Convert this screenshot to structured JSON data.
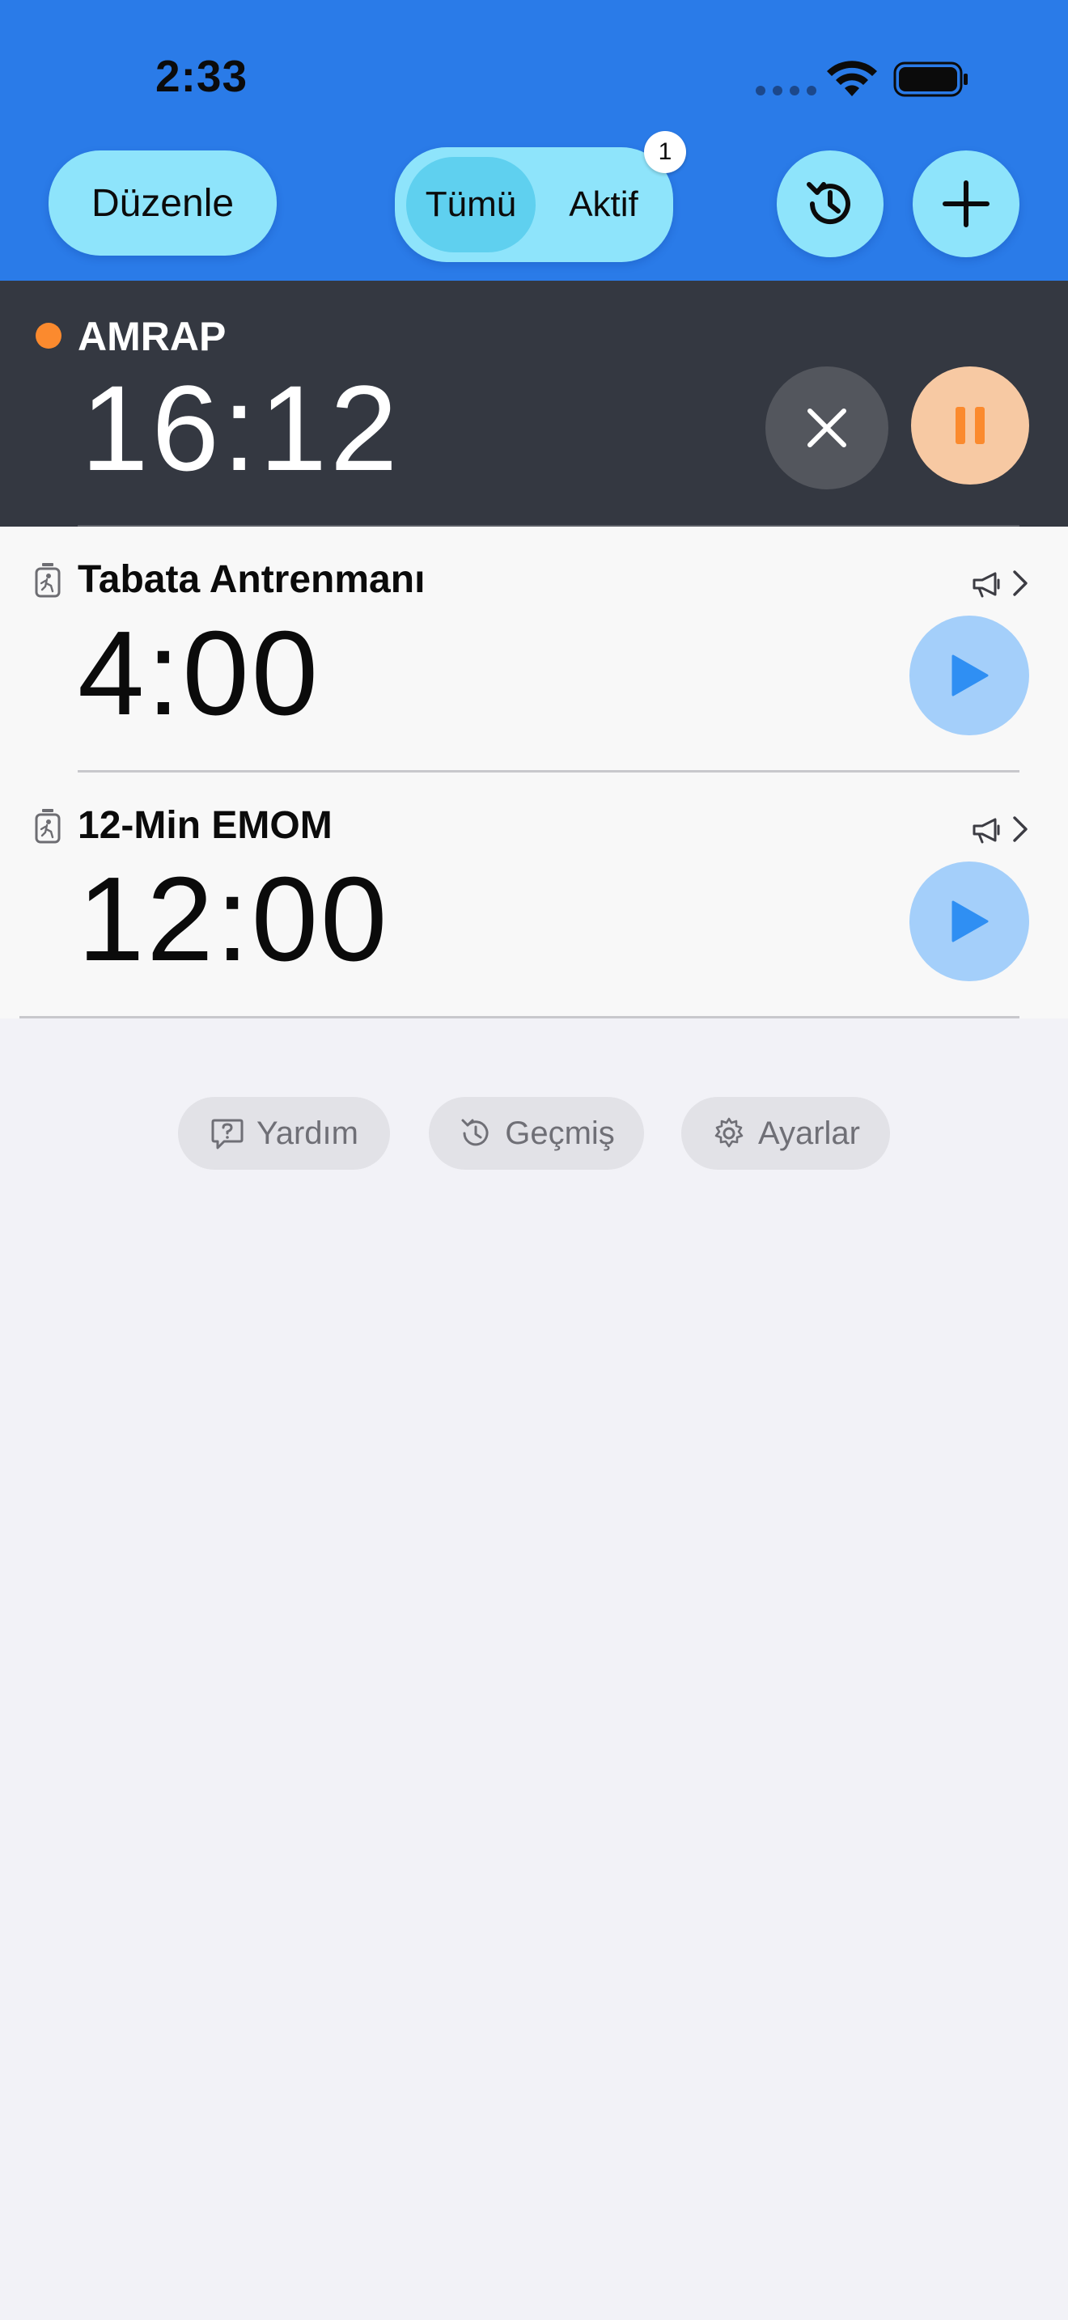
{
  "status_bar": {
    "time": "2:33",
    "icons": [
      "signal-dots-icon",
      "wifi-icon",
      "battery-icon"
    ]
  },
  "header": {
    "edit_label": "Düzenle",
    "segments": [
      {
        "label": "Tümü",
        "selected": true
      },
      {
        "label": "Aktif",
        "selected": false
      }
    ],
    "active_badge": "1",
    "buttons": [
      "history-icon",
      "plus-icon"
    ]
  },
  "active_timer": {
    "title": "AMRAP",
    "time": "16:12",
    "state": "running",
    "indicator_color": "#fb8a2e"
  },
  "timers": [
    {
      "title": "Tabata Antrenmanı",
      "duration": "4:00"
    },
    {
      "title": "12-Min EMOM",
      "duration": "12:00"
    }
  ],
  "footer": {
    "help_label": "Yardım",
    "history_label": "Geçmiş",
    "settings_label": "Ayarlar"
  },
  "colors": {
    "header_bg": "#2a7be8",
    "pill_bg": "#8ee4fb",
    "active_row_bg": "#343841",
    "pause_bg": "#f7c9a3",
    "pause_accent": "#fb8a2e",
    "play_bg": "#a4cffa",
    "play_accent": "#2f8ff3"
  }
}
